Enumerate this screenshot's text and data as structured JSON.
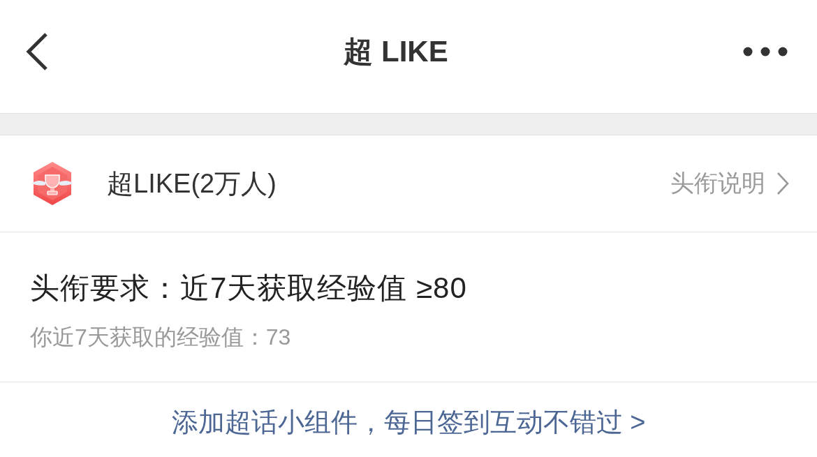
{
  "header": {
    "title": "超 LIKE"
  },
  "title_row": {
    "name": "超LIKE(2万人)",
    "link": "头衔说明"
  },
  "requirement": {
    "text": "头衔要求：近7天获取经验值 ≥80",
    "progress": "你近7天获取的经验值：73"
  },
  "footer_link": "添加超话小组件，每日签到互动不错过 >"
}
